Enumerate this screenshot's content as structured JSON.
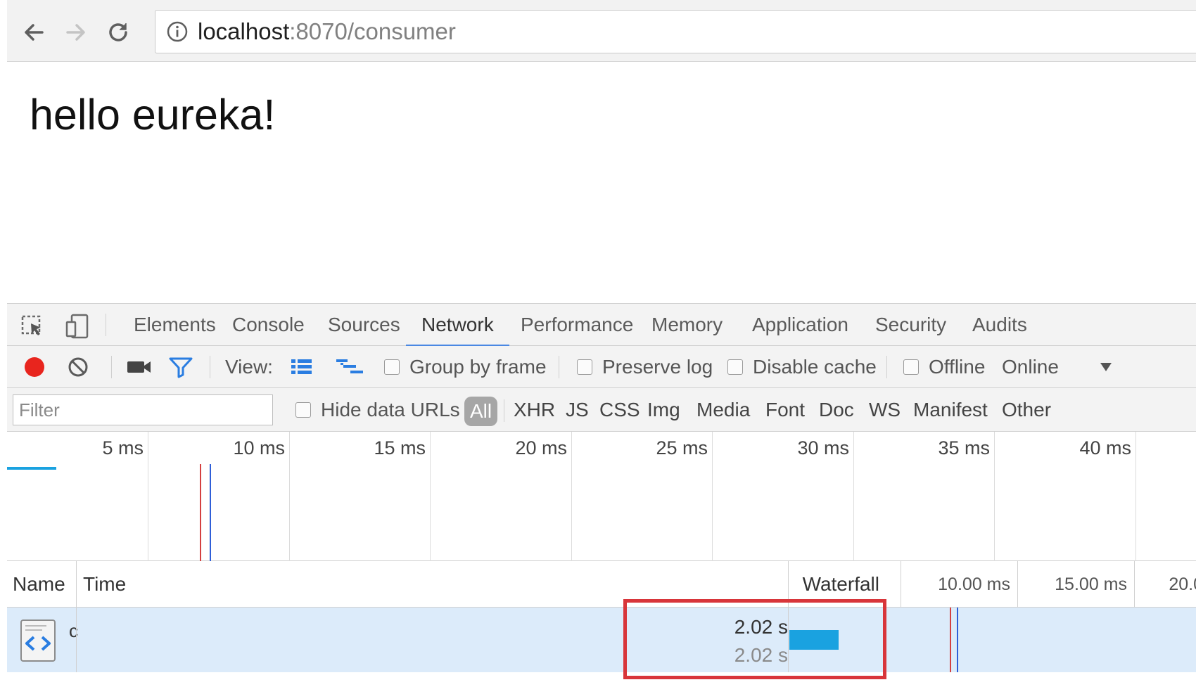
{
  "browser": {
    "url_host": "localhost",
    "url_path": ":8070/consumer"
  },
  "page": {
    "heading": "hello eureka!"
  },
  "devtools": {
    "tabs": [
      {
        "label": "Elements"
      },
      {
        "label": "Console"
      },
      {
        "label": "Sources"
      },
      {
        "label": "Network",
        "active": true
      },
      {
        "label": "Performance"
      },
      {
        "label": "Memory"
      },
      {
        "label": "Application"
      },
      {
        "label": "Security"
      },
      {
        "label": "Audits"
      }
    ],
    "toolbar": {
      "view_label": "View:",
      "group_by_frame": "Group by frame",
      "preserve_log": "Preserve log",
      "disable_cache": "Disable cache",
      "offline": "Offline",
      "throttling": "Online"
    },
    "filter": {
      "placeholder": "Filter",
      "hide_data_urls": "Hide data URLs",
      "types": [
        "All",
        "XHR",
        "JS",
        "CSS",
        "Img",
        "Media",
        "Font",
        "Doc",
        "WS",
        "Manifest",
        "Other"
      ]
    },
    "overview": {
      "ticks": [
        "5 ms",
        "10 ms",
        "15 ms",
        "20 ms",
        "25 ms",
        "30 ms",
        "35 ms",
        "40 ms"
      ]
    },
    "table": {
      "columns": {
        "name": "Name",
        "time": "Time",
        "waterfall": "Waterfall"
      },
      "waterfall_ticks": [
        "10.00 ms",
        "15.00 ms",
        "20.0"
      ],
      "rows": [
        {
          "name": "c",
          "time": "2.02 s",
          "latency": "2.02 s"
        }
      ]
    },
    "colors": {
      "record": "#e8251e",
      "accent": "#4a88e3",
      "bar": "#1aa2e0",
      "highlight_box": "#d8353a",
      "selected_row": "#dcebfa"
    }
  }
}
